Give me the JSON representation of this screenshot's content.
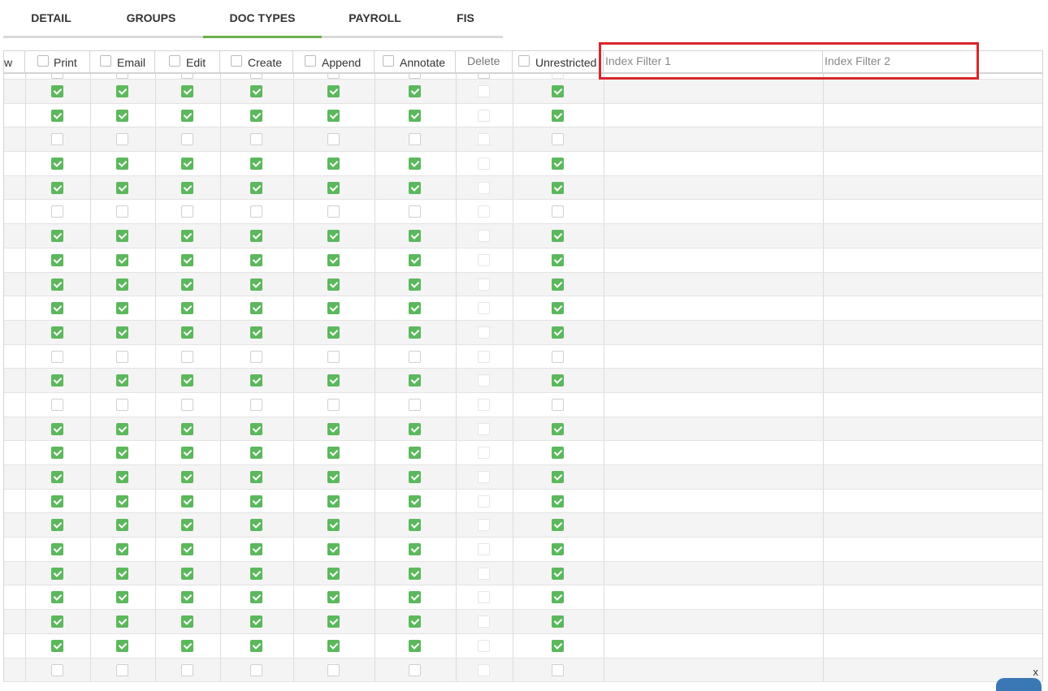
{
  "tabs": [
    {
      "label": "DETAIL",
      "active": false
    },
    {
      "label": "GROUPS",
      "active": false
    },
    {
      "label": "DOC TYPES",
      "active": true
    },
    {
      "label": "PAYROLL",
      "active": false
    },
    {
      "label": "FIS",
      "active": false
    }
  ],
  "columns": [
    {
      "label": "w",
      "checkbox": false
    },
    {
      "label": "Print",
      "checkbox": true
    },
    {
      "label": "Email",
      "checkbox": true
    },
    {
      "label": "Edit",
      "checkbox": true
    },
    {
      "label": "Create",
      "checkbox": true
    },
    {
      "label": "Append",
      "checkbox": true
    },
    {
      "label": "Annotate",
      "checkbox": true
    },
    {
      "label": "Delete",
      "checkbox": false
    },
    {
      "label": "Unrestricted",
      "checkbox": true
    },
    {
      "label": "Index Filter 1",
      "checkbox": false
    },
    {
      "label": "Index Filter 2",
      "checkbox": false
    }
  ],
  "rows_checked": [
    true,
    true,
    false,
    true,
    true,
    false,
    true,
    true,
    true,
    true,
    true,
    false,
    true,
    false,
    true,
    true,
    true,
    true,
    true,
    true,
    true,
    true,
    true,
    true,
    false
  ],
  "colors": {
    "accent": "#6ab04c",
    "checkbox_on": "#5cb85c",
    "highlight": "#d9262b"
  },
  "close_label": "x"
}
